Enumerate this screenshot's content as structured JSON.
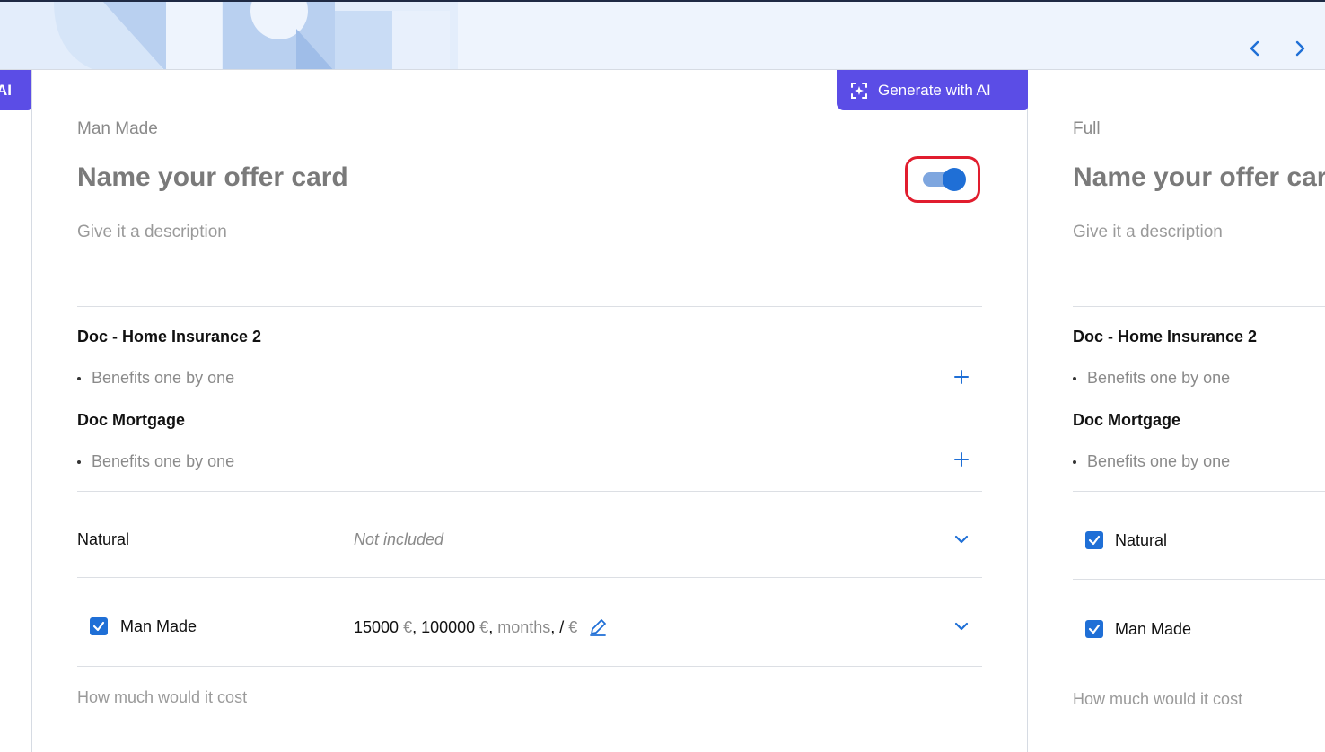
{
  "header": {
    "prev_icon": "chevron-left-icon",
    "next_icon": "chevron-right-icon",
    "accent": "#1f6fd6"
  },
  "left_stub": {
    "label": "AI"
  },
  "main_card": {
    "generate_button": {
      "label": "Generate with AI",
      "icon": "sparkle-icon",
      "color": "#5b4de6"
    },
    "category": "Man Made",
    "title_placeholder": "Name your offer card",
    "description_placeholder": "Give it a description",
    "toggle_on": true,
    "sections": [
      {
        "title": "Doc - Home Insurance 2",
        "benefit_placeholder": "Benefits one by one"
      },
      {
        "title": "Doc Mortgage",
        "benefit_placeholder": "Benefits one by one"
      }
    ],
    "coverages": [
      {
        "label": "Natural",
        "value": "Not included"
      },
      {
        "label": "Man Made",
        "checked": true,
        "amount1": "15000",
        "amount2": "100000",
        "currency": "€",
        "period": "months",
        "sep": ",",
        "slash": "/"
      }
    ],
    "cost_placeholder": "How much would it cost"
  },
  "right_card": {
    "category": "Full",
    "title_placeholder": "Name your offer card",
    "description_placeholder": "Give it a description",
    "sections": [
      {
        "title": "Doc - Home Insurance 2",
        "benefit_placeholder": "Benefits one by one"
      },
      {
        "title": "Doc Mortgage",
        "benefit_placeholder": "Benefits one by one"
      }
    ],
    "coverages": [
      {
        "label": "Natural",
        "checked": true
      },
      {
        "label": "Man Made",
        "checked": true
      }
    ],
    "cost_placeholder": "How much would it cost"
  }
}
